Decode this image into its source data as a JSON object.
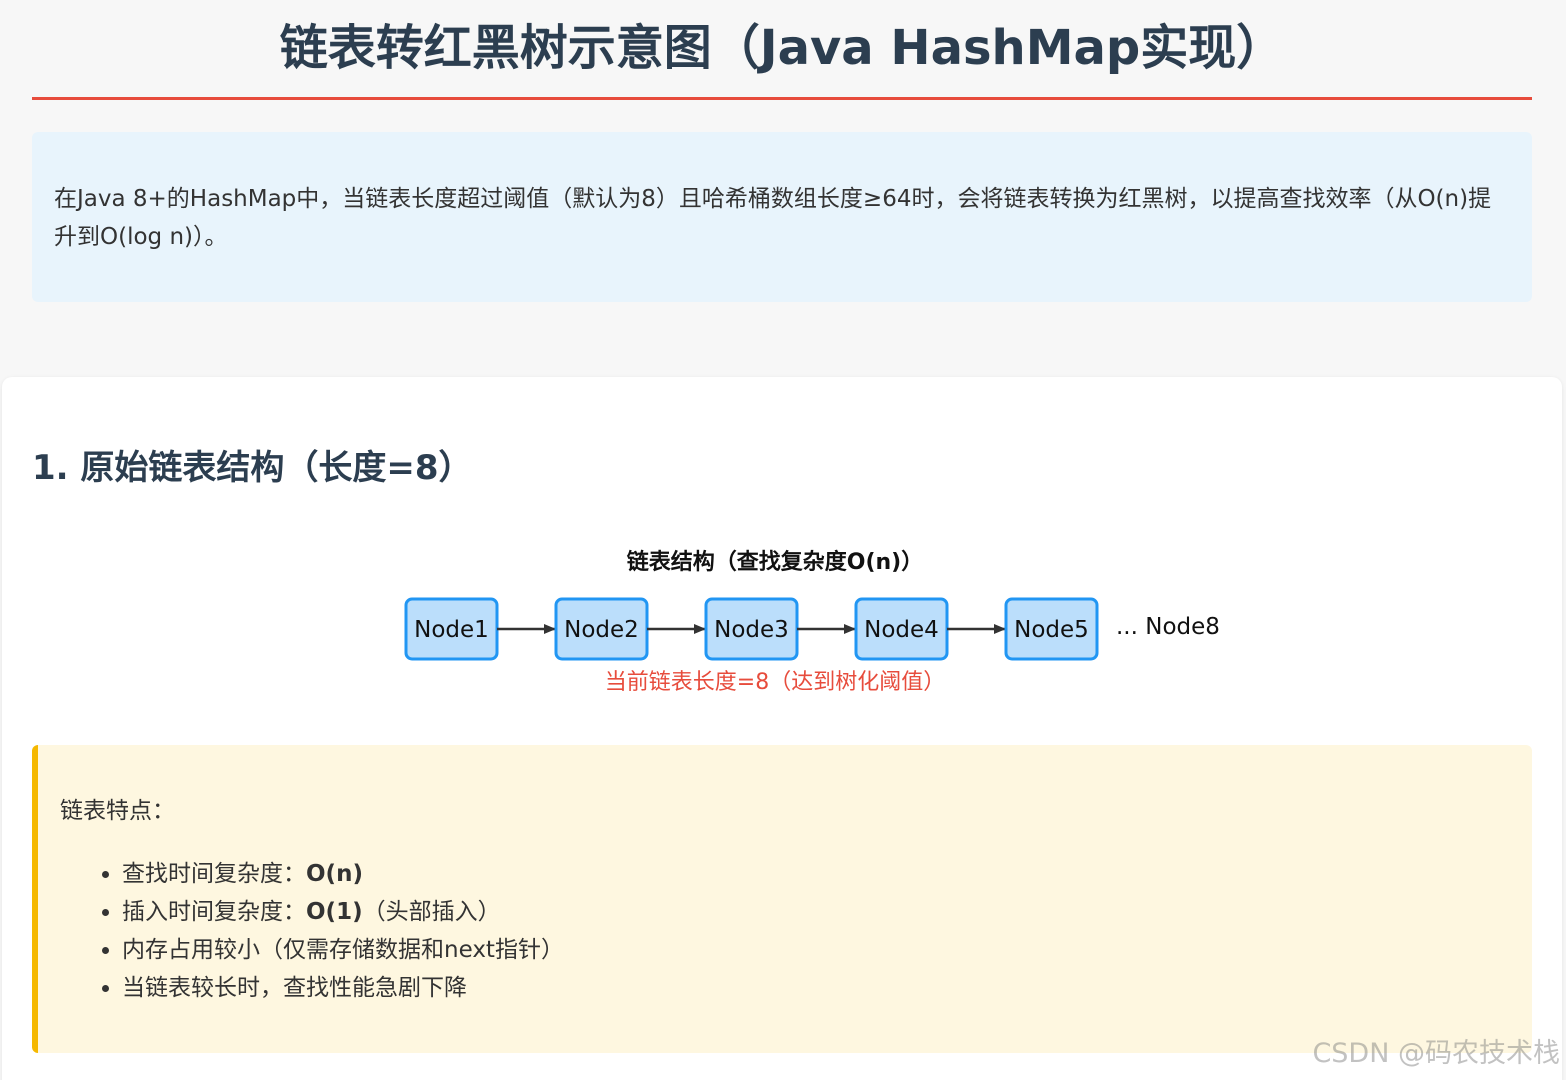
{
  "title": "链表转红黑树示意图（Java HashMap实现）",
  "intro": "在Java 8+的HashMap中，当链表长度超过阈值（默认为8）且哈希桶数组长度≥64时，会将链表转换为红黑树，以提高查找效率（从O(n)提升到O(log n)）。",
  "section1": {
    "title": "1. 原始链表结构（长度=8）"
  },
  "diagram": {
    "title": "链表结构（查找复杂度O(n)）",
    "nodes": [
      "Node1",
      "Node2",
      "Node3",
      "Node4",
      "Node5"
    ],
    "ellipsis": "... Node8",
    "note": "当前链表长度=8（达到树化阈值）",
    "node_fill": "#bbdefb",
    "node_stroke": "#2196f3",
    "arrow_color": "#333333"
  },
  "features": {
    "heading": "链表特点：",
    "items": [
      {
        "prefix": "查找时间复杂度：",
        "bold": "O(n)",
        "suffix": ""
      },
      {
        "prefix": "插入时间复杂度：",
        "bold": "O(1)",
        "suffix": "（头部插入）"
      },
      {
        "prefix": "内存占用较小（仅需存储数据和next指针）",
        "bold": "",
        "suffix": ""
      },
      {
        "prefix": "当链表较长时，查找性能急剧下降",
        "bold": "",
        "suffix": ""
      }
    ]
  },
  "watermark": "CSDN @码农技术栈",
  "colors": {
    "title": "#2c3e50",
    "accent_red": "#e74c3c",
    "intro_bg": "#e8f4fc",
    "feature_bg": "#fef7e0",
    "feature_border": "#f5b800"
  }
}
